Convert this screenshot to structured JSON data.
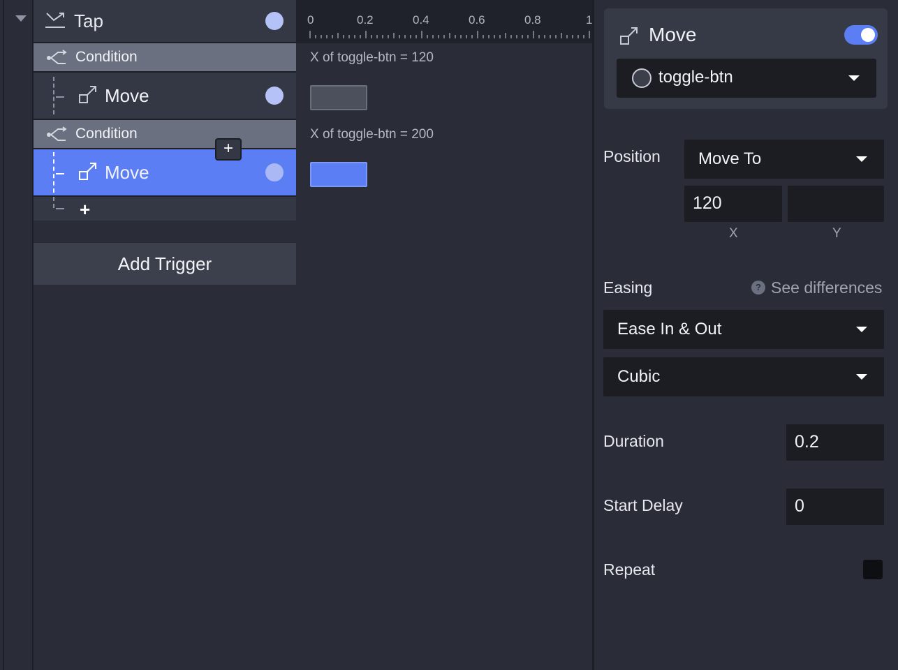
{
  "tree": {
    "trigger_label": "Tap",
    "items": [
      {
        "type": "condition",
        "label": "Condition"
      },
      {
        "type": "action",
        "label": "Move",
        "selected": false
      },
      {
        "type": "condition",
        "label": "Condition"
      },
      {
        "type": "action",
        "label": "Move",
        "selected": true
      }
    ],
    "add_action_symbol": "+",
    "insert_symbol": "+",
    "add_trigger_label": "Add Trigger"
  },
  "timeline": {
    "ruler_labels": [
      "0",
      "0.2",
      "0.4",
      "0.6",
      "0.8",
      "1"
    ],
    "rows": [
      {
        "label": "X of toggle-btn = 120",
        "state": "grey"
      },
      {
        "label": "X of toggle-btn = 200",
        "state": "blue"
      }
    ]
  },
  "props": {
    "title": "Move",
    "enabled": true,
    "target": "toggle-btn",
    "position_label": "Position",
    "position_mode": "Move To",
    "x_value": "120",
    "y_value": "",
    "x_label": "X",
    "y_label": "Y",
    "easing_label": "Easing",
    "help_symbol": "?",
    "see_differences": "See differences",
    "easing_type": "Ease In & Out",
    "easing_curve": "Cubic",
    "duration_label": "Duration",
    "duration_value": "0.2",
    "delay_label": "Start Delay",
    "delay_value": "0",
    "repeat_label": "Repeat",
    "repeat_checked": false
  },
  "colors": {
    "accent": "#5b7ef4",
    "panel_bg": "#2a2d38",
    "field_bg": "#1b1d23",
    "condition_bg": "#6b7080"
  },
  "icons": [
    "collapse-caret-icon",
    "tap-gesture-icon",
    "condition-branch-icon",
    "move-icon",
    "help-icon",
    "dropdown-caret-icon"
  ]
}
